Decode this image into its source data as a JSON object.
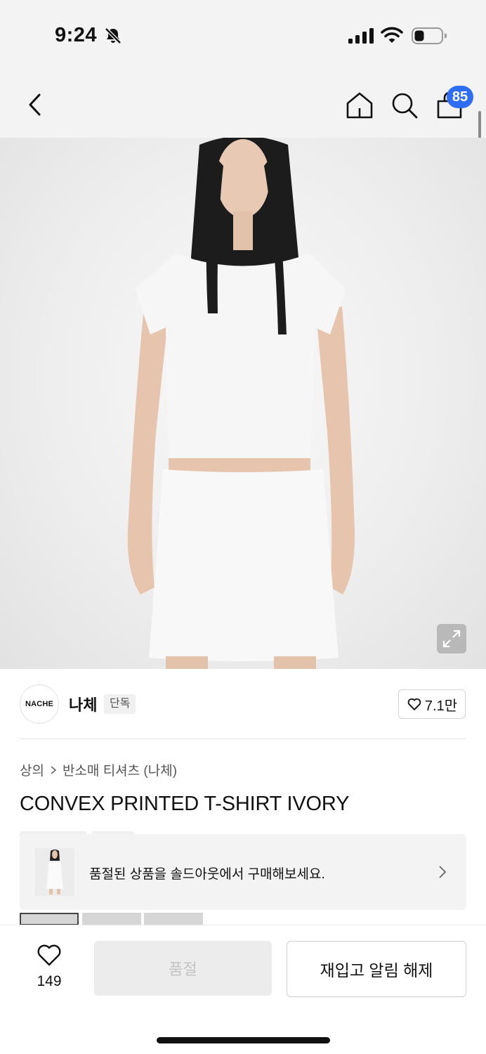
{
  "status_bar": {
    "time": "9:24"
  },
  "header": {
    "cart_count": "85"
  },
  "brand": {
    "logo_text": "NACHE",
    "name": "나체",
    "badge": "단독",
    "likes": "7.1만"
  },
  "breadcrumb": {
    "category": "상의",
    "subcategory": "반소매 티셔츠 (나체)"
  },
  "product": {
    "title": "CONVEX PRINTED T-SHIRT IVORY"
  },
  "soldout_banner": {
    "text": "품절된 상품을 솔드아웃에서 구매해보세요."
  },
  "bottom_bar": {
    "wish_count": "149",
    "soldout_label": "품절",
    "restock_label": "재입고 알림 해제"
  },
  "colors": {
    "accent": "#2f6ef2",
    "disabled_bg": "#ececec",
    "disabled_text": "#c3c3c3"
  }
}
